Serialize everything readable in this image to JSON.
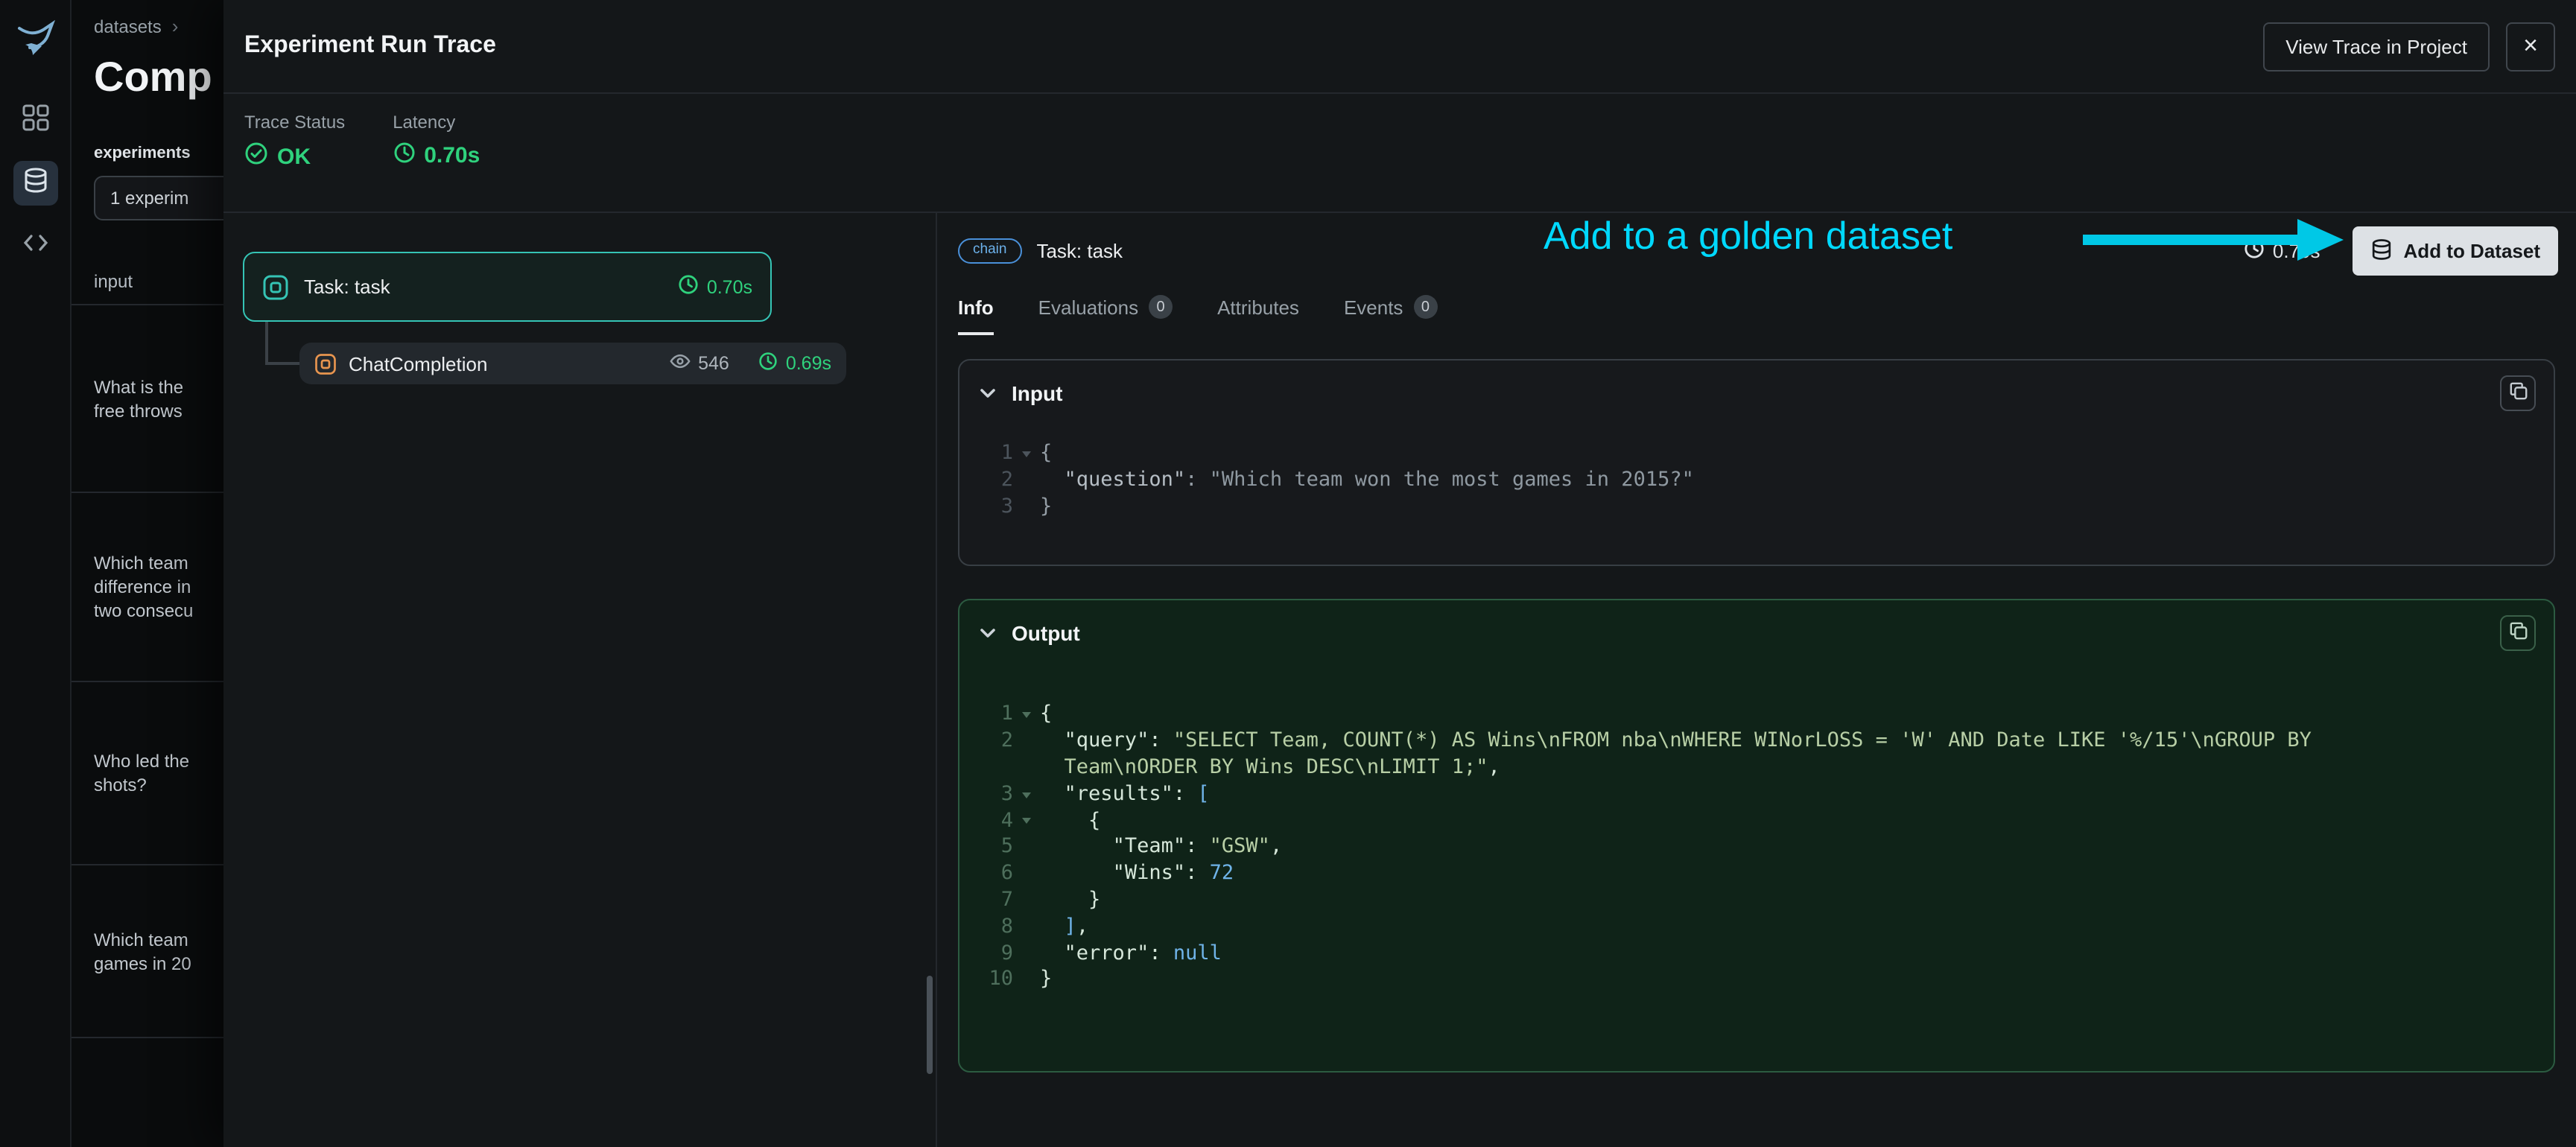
{
  "colors": {
    "status_green": "#2fd27d",
    "annotation_cyan": "#00d9ff",
    "selected_span_teal": "#35c4b5",
    "chatcompletion_orange": "#e8954f",
    "chain_badge_blue": "#6cb1ea",
    "output_border_green": "#2c5b41",
    "add_button_bg": "#dde1e5"
  },
  "sidebar": {
    "icons": [
      "phoenix-logo",
      "apps-grid",
      "datasets-database",
      "code-brackets"
    ],
    "selected": "datasets-database"
  },
  "datasets_page": {
    "breadcrumb": "datasets",
    "breadcrumb_chevron": "›",
    "title": "Comp",
    "experiments_label": "experiments",
    "experiment_selector": "1 experim",
    "table": {
      "header": "input",
      "rows": [
        {
          "lines": [
            "What is the",
            "free throws"
          ]
        },
        {
          "lines": [
            "Which team",
            "difference in",
            "two consecu"
          ]
        },
        {
          "lines": [
            "Who led the",
            "shots?"
          ]
        },
        {
          "lines": [
            "Which team",
            "games in 20"
          ]
        }
      ]
    }
  },
  "modal": {
    "title": "Experiment Run Trace",
    "view_trace_button": "View Trace in Project",
    "close_icon": "×",
    "trace_status": {
      "label": "Trace Status",
      "value": "OK"
    },
    "latency": {
      "label": "Latency",
      "value": "0.70s"
    },
    "tree": [
      {
        "name": "Task: task",
        "latency": "0.70s",
        "selected": true
      },
      {
        "name": "ChatCompletion",
        "tokens": "546",
        "latency": "0.69s",
        "selected": false
      }
    ],
    "detail": {
      "kind_badge": "chain",
      "span_title": "Task: task",
      "header_latency": "0.70s",
      "add_to_dataset_button": "Add to Dataset",
      "tabs": [
        {
          "label": "Info",
          "selected": true
        },
        {
          "label": "Evaluations",
          "count": "0",
          "selected": false
        },
        {
          "label": "Attributes",
          "selected": false
        },
        {
          "label": "Events",
          "count": "0",
          "selected": false
        }
      ],
      "input_section": {
        "title": "Input",
        "lines": [
          {
            "num": "1",
            "fold": true,
            "tokens": [
              {
                "t": "{",
                "c": "plain"
              }
            ]
          },
          {
            "num": "2",
            "tokens": [
              {
                "t": "  ",
                "c": "plain"
              },
              {
                "t": "\"question\"",
                "c": "key"
              },
              {
                "t": ": ",
                "c": "plain"
              },
              {
                "t": "\"Which team won the most games in 2015?\"",
                "c": "str"
              }
            ]
          },
          {
            "num": "3",
            "tokens": [
              {
                "t": "}",
                "c": "plain"
              }
            ]
          }
        ]
      },
      "output_section": {
        "title": "Output",
        "lines": [
          {
            "num": "1",
            "fold": true,
            "tokens": [
              {
                "t": "{",
                "c": "plain"
              }
            ]
          },
          {
            "num": "2",
            "tokens": [
              {
                "t": "  ",
                "c": "plain"
              },
              {
                "t": "\"query\"",
                "c": "key"
              },
              {
                "t": ": ",
                "c": "plain"
              },
              {
                "t": "\"SELECT Team, COUNT(*) AS Wins\\nFROM nba\\nWHERE WINorLOSS = 'W' AND Date LIKE '%/15'\\nGROUP BY",
                "c": "str"
              }
            ]
          },
          {
            "num": "",
            "tokens": [
              {
                "t": "  ",
                "c": "plain"
              },
              {
                "t": "Team\\nORDER BY Wins DESC\\nLIMIT 1;\"",
                "c": "str"
              },
              {
                "t": ",",
                "c": "plain"
              }
            ]
          },
          {
            "num": "3",
            "fold": true,
            "tokens": [
              {
                "t": "  ",
                "c": "plain"
              },
              {
                "t": "\"results\"",
                "c": "key"
              },
              {
                "t": ": ",
                "c": "plain"
              },
              {
                "t": "[",
                "c": "blue"
              }
            ]
          },
          {
            "num": "4",
            "fold": true,
            "tokens": [
              {
                "t": "    ",
                "c": "plain"
              },
              {
                "t": "{",
                "c": "plain"
              }
            ]
          },
          {
            "num": "5",
            "tokens": [
              {
                "t": "      ",
                "c": "plain"
              },
              {
                "t": "\"Team\"",
                "c": "key"
              },
              {
                "t": ": ",
                "c": "plain"
              },
              {
                "t": "\"GSW\"",
                "c": "str"
              },
              {
                "t": ",",
                "c": "plain"
              }
            ]
          },
          {
            "num": "6",
            "tokens": [
              {
                "t": "      ",
                "c": "plain"
              },
              {
                "t": "\"Wins\"",
                "c": "key"
              },
              {
                "t": ": ",
                "c": "plain"
              },
              {
                "t": "72",
                "c": "blue"
              }
            ]
          },
          {
            "num": "7",
            "tokens": [
              {
                "t": "    ",
                "c": "plain"
              },
              {
                "t": "}",
                "c": "plain"
              }
            ]
          },
          {
            "num": "8",
            "tokens": [
              {
                "t": "  ",
                "c": "plain"
              },
              {
                "t": "]",
                "c": "blue"
              },
              {
                "t": ",",
                "c": "plain"
              }
            ]
          },
          {
            "num": "9",
            "tokens": [
              {
                "t": "  ",
                "c": "plain"
              },
              {
                "t": "\"error\"",
                "c": "key"
              },
              {
                "t": ": ",
                "c": "plain"
              },
              {
                "t": "null",
                "c": "blue"
              }
            ]
          },
          {
            "num": "10",
            "tokens": [
              {
                "t": "}",
                "c": "plain"
              }
            ]
          }
        ]
      }
    }
  },
  "annotation": {
    "text": "Add to a golden dataset"
  }
}
